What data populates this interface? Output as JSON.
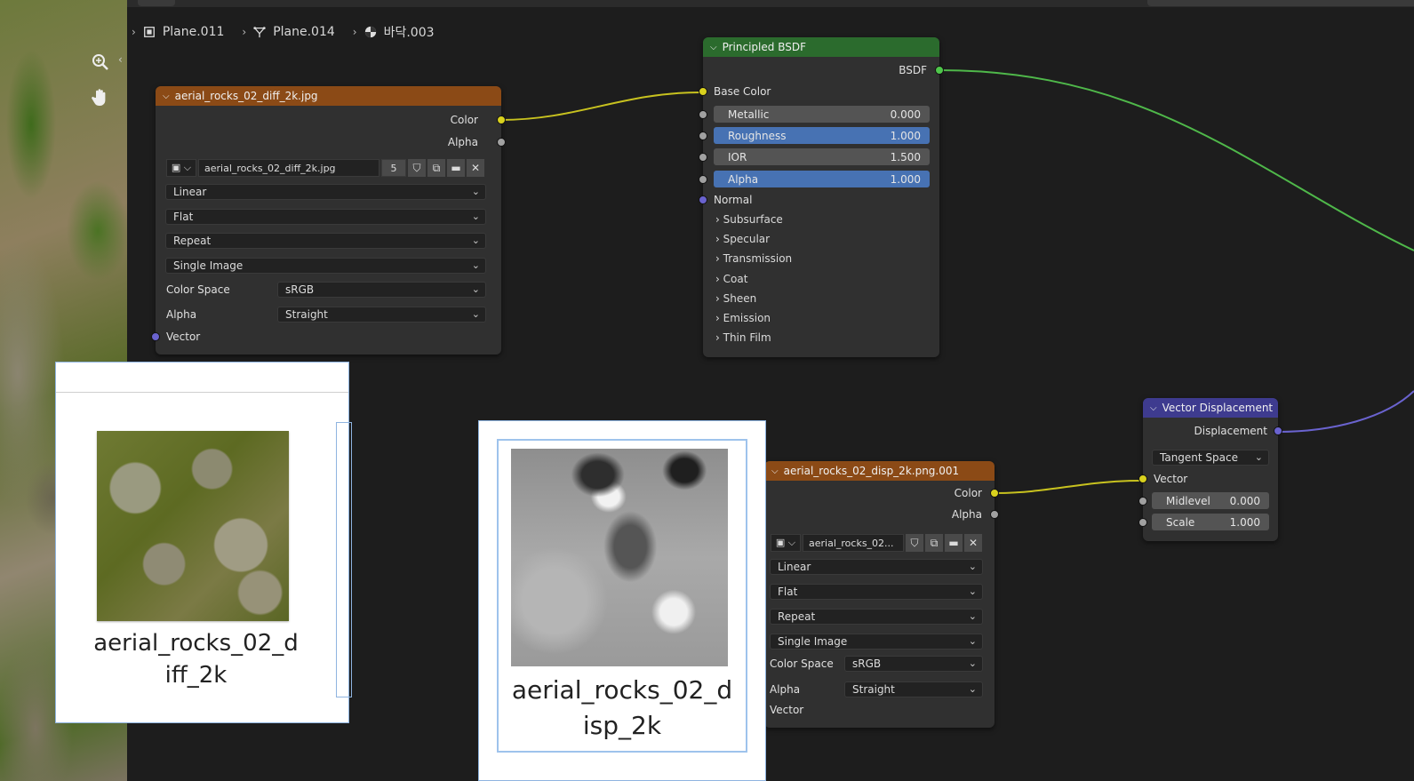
{
  "breadcrumb": {
    "items": [
      {
        "label": "Plane.011",
        "icon": "object-icon"
      },
      {
        "label": "Plane.014",
        "icon": "mesh-data-icon"
      },
      {
        "label": "바닥.003",
        "icon": "material-icon"
      }
    ]
  },
  "nav": {
    "zoom_icon": "zoom-icon",
    "pan_icon": "hand-pan-icon"
  },
  "node_diff": {
    "title": "aerial_rocks_02_diff_2k.jpg",
    "out_color": "Color",
    "out_alpha": "Alpha",
    "image_name": "aerial_rocks_02_diff_2k.jpg",
    "users": "5",
    "interpolation": "Linear",
    "projection": "Flat",
    "extension": "Repeat",
    "source": "Single Image",
    "colorspace_label": "Color Space",
    "colorspace_value": "sRGB",
    "alpha_label": "Alpha",
    "alpha_value": "Straight",
    "in_vector": "Vector"
  },
  "node_bsdf": {
    "title": "Principled BSDF",
    "out_bsdf": "BSDF",
    "base_color": "Base Color",
    "metallic_label": "Metallic",
    "metallic_value": "0.000",
    "roughness_label": "Roughness",
    "roughness_value": "1.000",
    "ior_label": "IOR",
    "ior_value": "1.500",
    "alpha_label": "Alpha",
    "alpha_value": "1.000",
    "normal": "Normal",
    "panels": [
      "Subsurface",
      "Specular",
      "Transmission",
      "Coat",
      "Sheen",
      "Emission",
      "Thin Film"
    ]
  },
  "node_vecdisp": {
    "title": "Vector Displacement",
    "out_displacement": "Displacement",
    "space": "Tangent Space",
    "in_vector": "Vector",
    "midlevel_label": "Midlevel",
    "midlevel_value": "0.000",
    "scale_label": "Scale",
    "scale_value": "1.000"
  },
  "node_disp": {
    "title": "aerial_rocks_02_disp_2k.png.001",
    "out_color": "Color",
    "out_alpha": "Alpha",
    "image_name": "aerial_rocks_02...",
    "interpolation": "Linear",
    "projection": "Flat",
    "extension": "Repeat",
    "source": "Single Image",
    "colorspace_label": "Color Space",
    "colorspace_value": "sRGB",
    "alpha_label": "Alpha",
    "alpha_value": "Straight",
    "in_vector": "Vector"
  },
  "thumb_diff": {
    "caption_line1": "aerial_rocks_02_d",
    "caption_line2": "iff_2k"
  },
  "thumb_disp": {
    "caption_line1": "aerial_rocks_02_d",
    "caption_line2": "isp_2k"
  },
  "colors": {
    "editor_bg": "#1d1d1d",
    "node_bg": "#303030",
    "image_header": "#8b4a16",
    "shader_header": "#2b6b2d",
    "vector_header": "#3e3b8f",
    "link_yellow": "#c8c21f",
    "link_green": "#4fb84a",
    "link_purple": "#6a63cf",
    "field_blue": "#4772b3"
  }
}
